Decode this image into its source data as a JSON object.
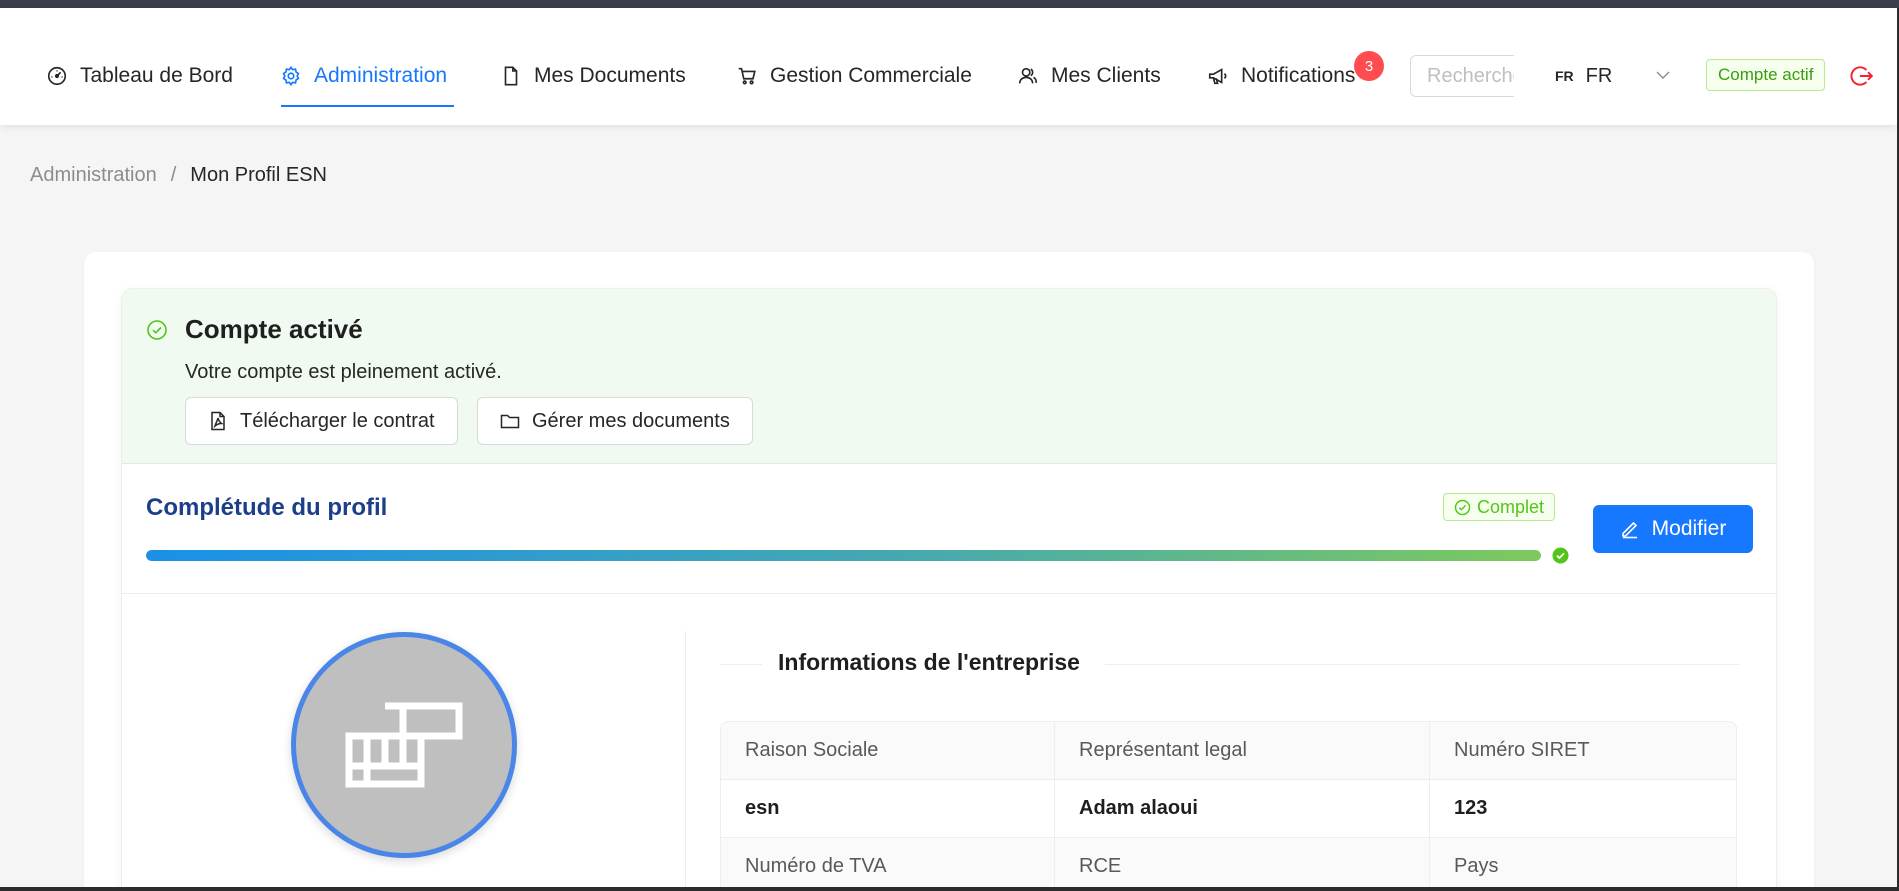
{
  "nav": {
    "items": [
      {
        "label": "Tableau de Bord",
        "icon": "dashboard-icon"
      },
      {
        "label": "Administration",
        "icon": "gear-icon",
        "active": true
      },
      {
        "label": "Mes Documents",
        "icon": "file-icon"
      },
      {
        "label": "Gestion Commerciale",
        "icon": "cart-icon"
      },
      {
        "label": "Mes Clients",
        "icon": "users-icon"
      },
      {
        "label": "Notifications",
        "icon": "megaphone-icon"
      }
    ],
    "notification_count": "3",
    "search_placeholder": "Rechercher",
    "language_code": "FR",
    "language_label": "FR",
    "account_status": "Compte actif",
    "accent_color": "#1677ff"
  },
  "breadcrumb": {
    "parent": "Administration",
    "separator": "/",
    "current": "Mon Profil ESN"
  },
  "alert": {
    "title": "Compte activé",
    "description": "Votre compte est pleinement activé.",
    "download_contract_label": "Télécharger le contrat",
    "manage_documents_label": "Gérer mes documents"
  },
  "profile_completion": {
    "title": "Complétude du profil",
    "status_label": "Complet",
    "progress_percent": 100,
    "edit_label": "Modifier"
  },
  "company_info": {
    "section_title": "Informations de l'entreprise",
    "headers": [
      "Raison Sociale",
      "Représentant legal",
      "Numéro SIRET"
    ],
    "values": [
      "esn",
      "Adam alaoui",
      "123"
    ],
    "headers_2": [
      "Numéro de TVA",
      "RCE",
      "Pays"
    ]
  }
}
